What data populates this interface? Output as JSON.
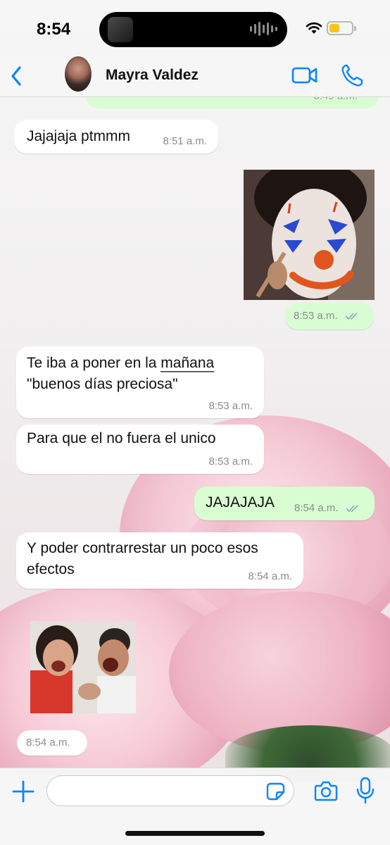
{
  "status_bar": {
    "time": "8:54",
    "battery_color": "#f5c518"
  },
  "header": {
    "back_icon": "chevron-left-icon",
    "contact_name": "Mayra Valdez",
    "video_icon": "video-camera-icon",
    "phone_icon": "phone-icon",
    "accent_color": "#0a84ff"
  },
  "messages": [
    {
      "direction": "out",
      "type": "text",
      "text": "",
      "time": "8:49 a.m.",
      "read": true,
      "partial": true
    },
    {
      "direction": "in",
      "type": "text",
      "text": "Jajajaja ptmmm",
      "time": "8:51 a.m."
    },
    {
      "direction": "out",
      "type": "image",
      "image": "girl-with-clown-makeup",
      "time": "8:53 a.m.",
      "read": true
    },
    {
      "direction": "in",
      "type": "text",
      "text_line1": "Te iba a poner en la mañana",
      "text_line2": "\"buenos días preciosa\"",
      "link_text": "la mañana",
      "time": "8:53 a.m."
    },
    {
      "direction": "in",
      "type": "text",
      "text": "Para que el no fuera el unico",
      "time": "8:53 a.m."
    },
    {
      "direction": "out",
      "type": "text",
      "text": "JAJAJAJA",
      "time": "8:54 a.m.",
      "read": true
    },
    {
      "direction": "in",
      "type": "text",
      "text_line1": "Y poder contrarrestar un poco esos",
      "text_line2": "efectos",
      "time": "8:54 a.m."
    },
    {
      "direction": "in",
      "type": "sticker",
      "image": "two-people-laughing",
      "time": "8:54 a.m."
    }
  ],
  "input_bar": {
    "placeholder": "",
    "attach_icon": "plus-icon",
    "sticker_icon": "sticker-icon",
    "camera_icon": "camera-icon",
    "mic_icon": "microphone-icon"
  },
  "colors": {
    "incoming_bubble": "#ffffff",
    "outgoing_bubble": "#d9fdd3",
    "read_ticks": "#8fa8bf"
  }
}
